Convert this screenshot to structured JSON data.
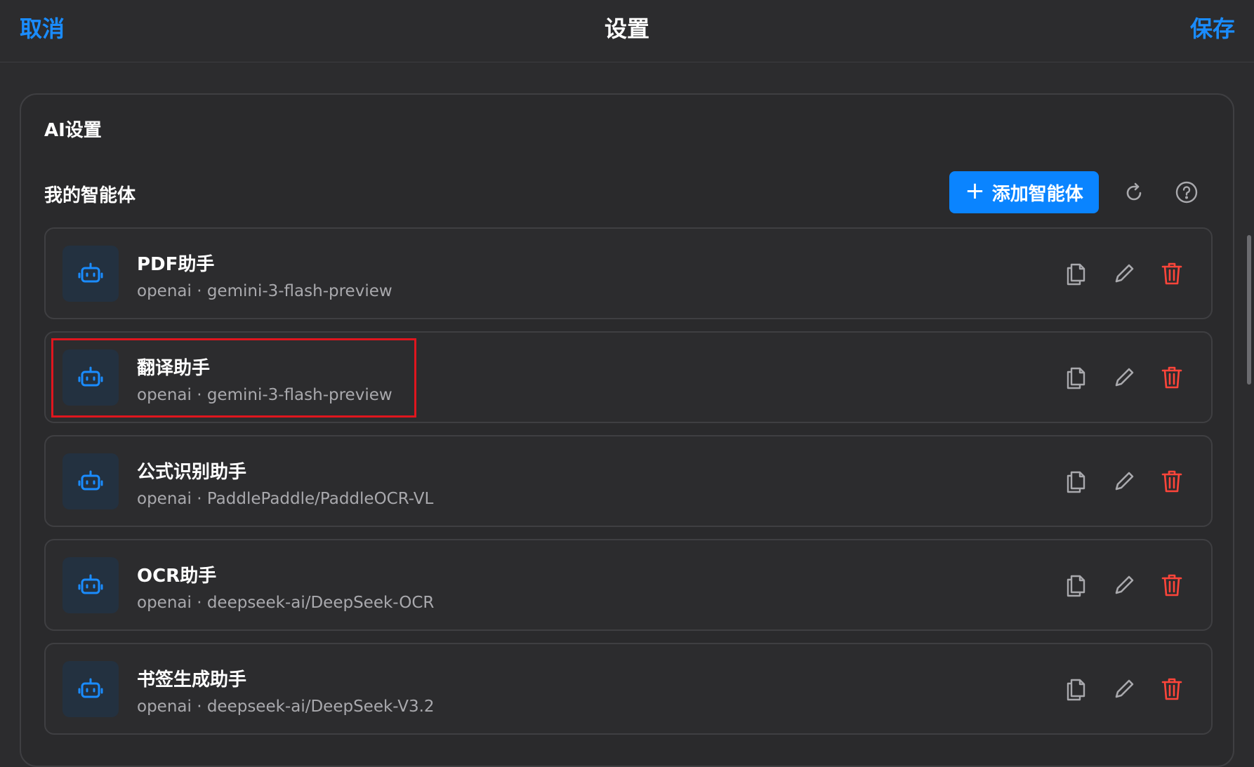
{
  "header": {
    "cancel_label": "取消",
    "title": "设置",
    "save_label": "保存"
  },
  "panel": {
    "title": "AI设置",
    "section_title": "我的智能体",
    "add_button_label": "添加智能体"
  },
  "agents": [
    {
      "name": "PDF助手",
      "subtitle": "openai · gemini-3-flash-preview"
    },
    {
      "name": "翻译助手",
      "subtitle": "openai · gemini-3-flash-preview",
      "highlighted": true
    },
    {
      "name": "公式识别助手",
      "subtitle": "openai · PaddlePaddle/PaddleOCR-VL"
    },
    {
      "name": "OCR助手",
      "subtitle": "openai · deepseek-ai/DeepSeek-OCR"
    },
    {
      "name": "书签生成助手",
      "subtitle": "openai · deepseek-ai/DeepSeek-V3.2"
    }
  ],
  "icons": {
    "agent": "robot-icon",
    "copy": "copy-icon",
    "edit": "pencil-icon",
    "delete": "trash-icon",
    "refresh": "refresh-icon",
    "help": "help-icon",
    "add": "plus-icon"
  },
  "colors": {
    "accent": "#0a84ff",
    "danger": "#ff453a",
    "highlight_border": "#e0161e",
    "background": "#2c2c2e"
  }
}
